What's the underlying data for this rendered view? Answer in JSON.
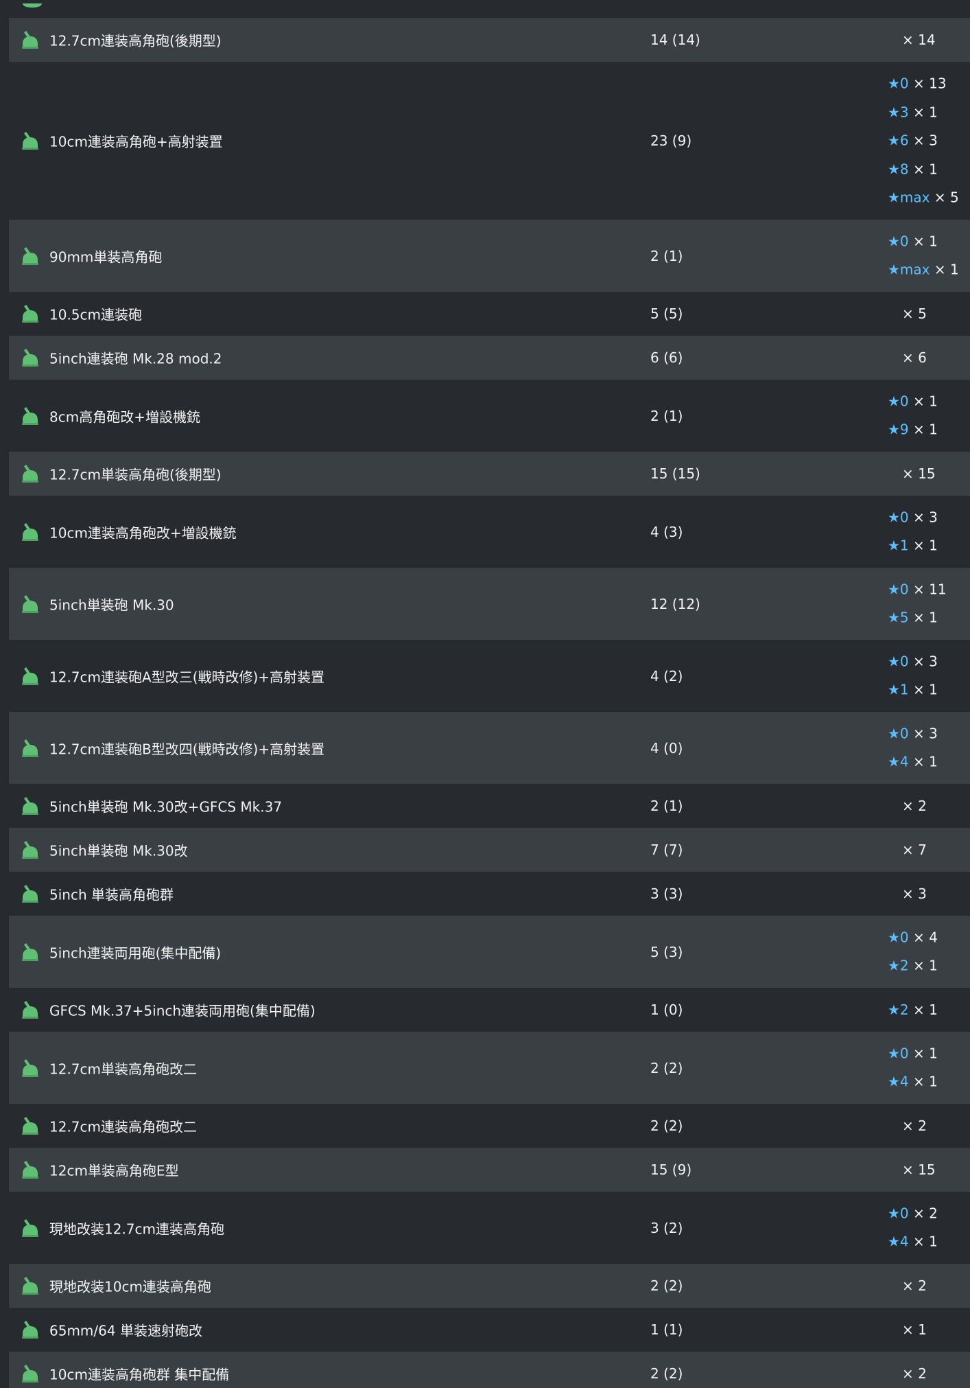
{
  "theme": {
    "background": "#272b30",
    "row_alt_background": "#3a3f44",
    "text": "#f2f2f2",
    "star_color": "#5bc0ff",
    "icon_color": "#5fbf73"
  },
  "icon_name": "aa-gun-icon",
  "rows": [
    {
      "name": "12.7cm連装高角砲(後期型)",
      "count": "14 (14)",
      "stars": [
        {
          "star": "",
          "mult": "× 14"
        }
      ]
    },
    {
      "name": "10cm連装高角砲+高射装置",
      "count": "23 (9)",
      "stars": [
        {
          "star": "★0",
          "mult": "× 13"
        },
        {
          "star": "★3",
          "mult": "× 1"
        },
        {
          "star": "★6",
          "mult": "× 3"
        },
        {
          "star": "★8",
          "mult": "× 1"
        },
        {
          "star": "★max",
          "mult": "× 5"
        }
      ]
    },
    {
      "name": "90mm単装高角砲",
      "count": "2 (1)",
      "stars": [
        {
          "star": "★0",
          "mult": "× 1"
        },
        {
          "star": "★max",
          "mult": "× 1"
        }
      ]
    },
    {
      "name": "10.5cm連装砲",
      "count": "5 (5)",
      "stars": [
        {
          "star": "",
          "mult": "× 5"
        }
      ]
    },
    {
      "name": "5inch連装砲 Mk.28 mod.2",
      "count": "6 (6)",
      "stars": [
        {
          "star": "",
          "mult": "× 6"
        }
      ]
    },
    {
      "name": "8cm高角砲改+増設機銃",
      "count": "2 (1)",
      "stars": [
        {
          "star": "★0",
          "mult": "× 1"
        },
        {
          "star": "★9",
          "mult": "× 1"
        }
      ]
    },
    {
      "name": "12.7cm単装高角砲(後期型)",
      "count": "15 (15)",
      "stars": [
        {
          "star": "",
          "mult": "× 15"
        }
      ]
    },
    {
      "name": "10cm連装高角砲改+増設機銃",
      "count": "4 (3)",
      "stars": [
        {
          "star": "★0",
          "mult": "× 3"
        },
        {
          "star": "★1",
          "mult": "× 1"
        }
      ]
    },
    {
      "name": "5inch単装砲 Mk.30",
      "count": "12 (12)",
      "stars": [
        {
          "star": "★0",
          "mult": "× 11"
        },
        {
          "star": "★5",
          "mult": "× 1"
        }
      ]
    },
    {
      "name": "12.7cm連装砲A型改三(戦時改修)+高射装置",
      "count": "4 (2)",
      "stars": [
        {
          "star": "★0",
          "mult": "× 3"
        },
        {
          "star": "★1",
          "mult": "× 1"
        }
      ]
    },
    {
      "name": "12.7cm連装砲B型改四(戦時改修)+高射装置",
      "count": "4 (0)",
      "stars": [
        {
          "star": "★0",
          "mult": "× 3"
        },
        {
          "star": "★4",
          "mult": "× 1"
        }
      ]
    },
    {
      "name": "5inch単装砲 Mk.30改+GFCS Mk.37",
      "count": "2 (1)",
      "stars": [
        {
          "star": "",
          "mult": "× 2"
        }
      ]
    },
    {
      "name": "5inch単装砲 Mk.30改",
      "count": "7 (7)",
      "stars": [
        {
          "star": "",
          "mult": "× 7"
        }
      ]
    },
    {
      "name": "5inch 単装高角砲群",
      "count": "3 (3)",
      "stars": [
        {
          "star": "",
          "mult": "× 3"
        }
      ]
    },
    {
      "name": "5inch連装両用砲(集中配備)",
      "count": "5 (3)",
      "stars": [
        {
          "star": "★0",
          "mult": "× 4"
        },
        {
          "star": "★2",
          "mult": "× 1"
        }
      ]
    },
    {
      "name": "GFCS Mk.37+5inch連装両用砲(集中配備)",
      "count": "1 (0)",
      "stars": [
        {
          "star": "★2",
          "mult": "× 1"
        }
      ]
    },
    {
      "name": "12.7cm単装高角砲改二",
      "count": "2 (2)",
      "stars": [
        {
          "star": "★0",
          "mult": "× 1"
        },
        {
          "star": "★4",
          "mult": "× 1"
        }
      ]
    },
    {
      "name": "12.7cm連装高角砲改二",
      "count": "2 (2)",
      "stars": [
        {
          "star": "",
          "mult": "× 2"
        }
      ]
    },
    {
      "name": "12cm単装高角砲E型",
      "count": "15 (9)",
      "stars": [
        {
          "star": "",
          "mult": "× 15"
        }
      ]
    },
    {
      "name": "現地改装12.7cm連装高角砲",
      "count": "3 (2)",
      "stars": [
        {
          "star": "★0",
          "mult": "× 2"
        },
        {
          "star": "★4",
          "mult": "× 1"
        }
      ]
    },
    {
      "name": "現地改装10cm連装高角砲",
      "count": "2 (2)",
      "stars": [
        {
          "star": "",
          "mult": "× 2"
        }
      ]
    },
    {
      "name": "65mm/64 単装速射砲改",
      "count": "1 (1)",
      "stars": [
        {
          "star": "",
          "mult": "× 1"
        }
      ]
    },
    {
      "name": "10cm連装高角砲群 集中配備",
      "count": "2 (2)",
      "stars": [
        {
          "star": "",
          "mult": "× 2"
        }
      ]
    }
  ]
}
